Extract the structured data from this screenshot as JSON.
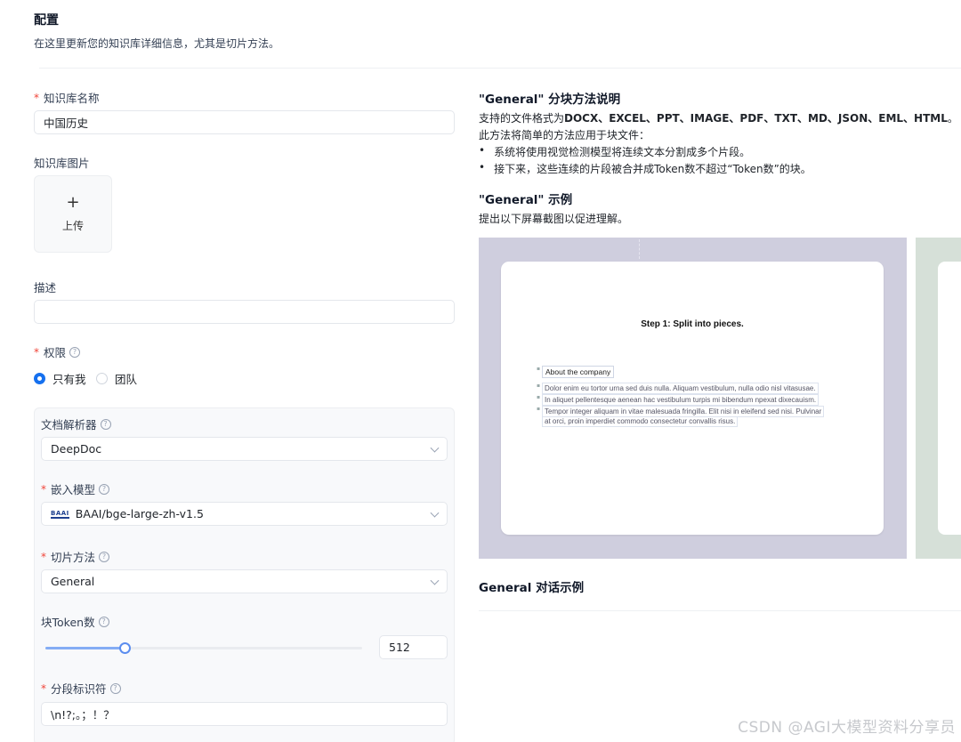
{
  "header": {
    "title": "配置",
    "subtitle": "在这里更新您的知识库详细信息，尤其是切片方法。"
  },
  "form": {
    "name": {
      "label": "知识库名称",
      "value": "中国历史"
    },
    "image": {
      "label": "知识库图片",
      "upload_plus": "+",
      "upload_label": "上传"
    },
    "description": {
      "label": "描述",
      "value": ""
    },
    "permission": {
      "label": "权限",
      "options": [
        {
          "label": "只有我",
          "checked": true
        },
        {
          "label": "团队",
          "checked": false
        }
      ]
    },
    "parser": {
      "label": "文档解析器",
      "value": "DeepDoc"
    },
    "embedding": {
      "label": "嵌入模型",
      "logo_text": "BAAI",
      "value": "BAAI/bge-large-zh-v1.5"
    },
    "chunk_method": {
      "label": "切片方法",
      "value": "General"
    },
    "chunk_tokens": {
      "label": "块Token数",
      "value": "512",
      "slider_fraction": 0.25
    },
    "delimiter": {
      "label": "分段标识符",
      "value": "\\n!?;。；！？"
    }
  },
  "help_icon": "question-circle-icon",
  "info": {
    "heading": "\"General\" 分块方法说明",
    "formats_prefix": "支持的文件格式为",
    "formats": "DOCX、EXCEL、PPT、IMAGE、PDF、TXT、MD、JSON、EML、HTML",
    "formats_suffix": "。",
    "intro": "此方法将简单的方法应用于块文件：",
    "bullets": [
      "系统将使用视觉检测模型将连续文本分割成多个片段。",
      "接下来，这些连续的片段被合并成Token数不超过“Token数”的块。"
    ],
    "example_heading": "\"General\" 示例",
    "example_text": "提出以下屏幕截图以促进理解。",
    "example_image": {
      "step_title": "Step 1: Split into pieces.",
      "doc_title": "About the company",
      "lines": [
        "Dolor enim eu tortor urna sed duis nulla. Aliquam vestibulum, nulla odio nisl vitasusae.",
        "In aliquet pellentesque aenean hac vestibulum turpis mi bibendum npexat dixecauism.",
        "Tempor integer aliquam in vitae malesuada fringilla. Elit nisi in eleifend sed nisi. Pulvinar",
        "at orci, proin imperdiet commodo consectetur convallis risus."
      ]
    },
    "dialog_heading": "General 对话示例"
  },
  "colors": {
    "accent": "#1570ef",
    "required": "#f04438",
    "example_bg": "#cfcede",
    "example_bg2": "#d6e0d8"
  },
  "watermark": "CSDN @AGI大模型资料分享员"
}
